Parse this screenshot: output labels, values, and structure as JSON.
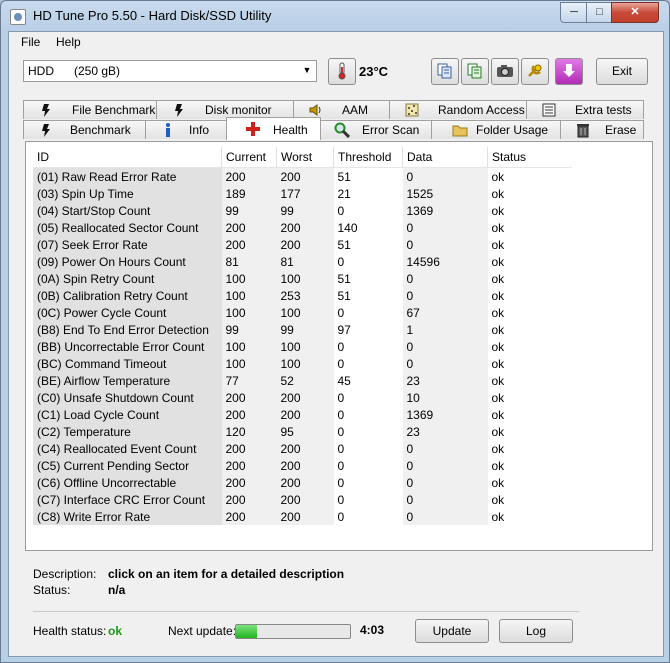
{
  "window": {
    "title": "HD Tune Pro 5.50 - Hard Disk/SSD Utility",
    "minimize": "─",
    "maximize": "□",
    "close": "✕"
  },
  "menu": {
    "file": "File",
    "help": "Help"
  },
  "toolbar": {
    "drive": "HDD      (250 gB)",
    "temperature": "23°C",
    "exit": "Exit"
  },
  "tabs_top": [
    {
      "label": "File Benchmark",
      "icon": "file-benchmark-icon"
    },
    {
      "label": "Disk monitor",
      "icon": "disk-monitor-icon"
    },
    {
      "label": "AAM",
      "icon": "speaker-icon"
    },
    {
      "label": "Random Access",
      "icon": "random-access-icon"
    },
    {
      "label": "Extra tests",
      "icon": "extra-tests-icon"
    }
  ],
  "tabs_bottom": [
    {
      "label": "Benchmark",
      "icon": "benchmark-icon"
    },
    {
      "label": "Info",
      "icon": "info-icon"
    },
    {
      "label": "Health",
      "icon": "health-cross-icon"
    },
    {
      "label": "Error Scan",
      "icon": "magnifier-icon"
    },
    {
      "label": "Folder Usage",
      "icon": "folder-icon"
    },
    {
      "label": "Erase",
      "icon": "trash-icon"
    }
  ],
  "table": {
    "headers": [
      "ID",
      "Current",
      "Worst",
      "Threshold",
      "Data",
      "Status"
    ],
    "rows": [
      [
        "(01) Raw Read Error Rate",
        "200",
        "200",
        "51",
        "0",
        "ok"
      ],
      [
        "(03) Spin Up Time",
        "189",
        "177",
        "21",
        "1525",
        "ok"
      ],
      [
        "(04) Start/Stop Count",
        "99",
        "99",
        "0",
        "1369",
        "ok"
      ],
      [
        "(05) Reallocated Sector Count",
        "200",
        "200",
        "140",
        "0",
        "ok"
      ],
      [
        "(07) Seek Error Rate",
        "200",
        "200",
        "51",
        "0",
        "ok"
      ],
      [
        "(09) Power On Hours Count",
        "81",
        "81",
        "0",
        "14596",
        "ok"
      ],
      [
        "(0A) Spin Retry Count",
        "100",
        "100",
        "51",
        "0",
        "ok"
      ],
      [
        "(0B) Calibration Retry Count",
        "100",
        "253",
        "51",
        "0",
        "ok"
      ],
      [
        "(0C) Power Cycle Count",
        "100",
        "100",
        "0",
        "67",
        "ok"
      ],
      [
        "(B8) End To End Error Detection",
        "99",
        "99",
        "97",
        "1",
        "ok"
      ],
      [
        "(BB) Uncorrectable Error Count",
        "100",
        "100",
        "0",
        "0",
        "ok"
      ],
      [
        "(BC) Command Timeout",
        "100",
        "100",
        "0",
        "0",
        "ok"
      ],
      [
        "(BE) Airflow Temperature",
        "77",
        "52",
        "45",
        "23",
        "ok"
      ],
      [
        "(C0) Unsafe Shutdown Count",
        "200",
        "200",
        "0",
        "10",
        "ok"
      ],
      [
        "(C1) Load Cycle Count",
        "200",
        "200",
        "0",
        "1369",
        "ok"
      ],
      [
        "(C2) Temperature",
        "120",
        "95",
        "0",
        "23",
        "ok"
      ],
      [
        "(C4) Reallocated Event Count",
        "200",
        "200",
        "0",
        "0",
        "ok"
      ],
      [
        "(C5) Current Pending Sector",
        "200",
        "200",
        "0",
        "0",
        "ok"
      ],
      [
        "(C6) Offline Uncorrectable",
        "200",
        "200",
        "0",
        "0",
        "ok"
      ],
      [
        "(C7) Interface CRC Error Count",
        "200",
        "200",
        "0",
        "0",
        "ok"
      ],
      [
        "(C8) Write Error Rate",
        "200",
        "200",
        "0",
        "0",
        "ok"
      ]
    ]
  },
  "details": {
    "description_label": "Description:",
    "description_value": "click on an item for a detailed description",
    "status_label": "Status:",
    "status_value": "n/a"
  },
  "footer": {
    "health_label": "Health status:",
    "health_value": "ok",
    "next_update_label": "Next update:",
    "progress": 0.18,
    "time": "4:03",
    "update": "Update",
    "log": "Log"
  },
  "colors": {
    "ok_green": "#1a9a1a",
    "progress_green": "#22b422",
    "health_cross": "#d0201a"
  }
}
